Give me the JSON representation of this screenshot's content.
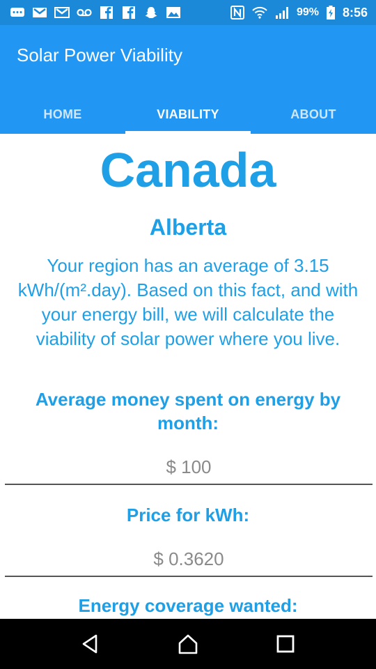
{
  "status_bar": {
    "battery_percent": "99%",
    "time": "8:56",
    "left_icons": [
      "chat-icon",
      "gmail-icon",
      "gmail-icon",
      "voicemail-icon",
      "facebook-icon",
      "facebook-icon",
      "snapchat-icon",
      "image-icon"
    ],
    "right_icons": [
      "nfc-icon",
      "wifi-icon",
      "signal-icon",
      "battery-icon"
    ]
  },
  "app_bar": {
    "title": "Solar Power Viability",
    "color": "#2196f3"
  },
  "tabs": [
    {
      "label": "HOME",
      "active": false
    },
    {
      "label": "VIABILITY",
      "active": true
    },
    {
      "label": "ABOUT",
      "active": false
    }
  ],
  "content": {
    "country": "Canada",
    "province": "Alberta",
    "description": "Your region has an average of 3.15 kWh/(m².day). Based on this fact, and with your energy bill, we will calculate the viability of solar power where you live.",
    "money_label": "Average money spent on energy by month:",
    "money_placeholder": "$ 100",
    "price_label": "Price for kWh:",
    "price_placeholder": "$ 0.3620",
    "coverage_label": "Energy coverage wanted:"
  },
  "nav_bar": {
    "buttons": [
      "back-icon",
      "home-icon",
      "recents-icon"
    ]
  },
  "colors": {
    "accent": "#1e9fe6",
    "status_bar": "#1b88d8"
  }
}
